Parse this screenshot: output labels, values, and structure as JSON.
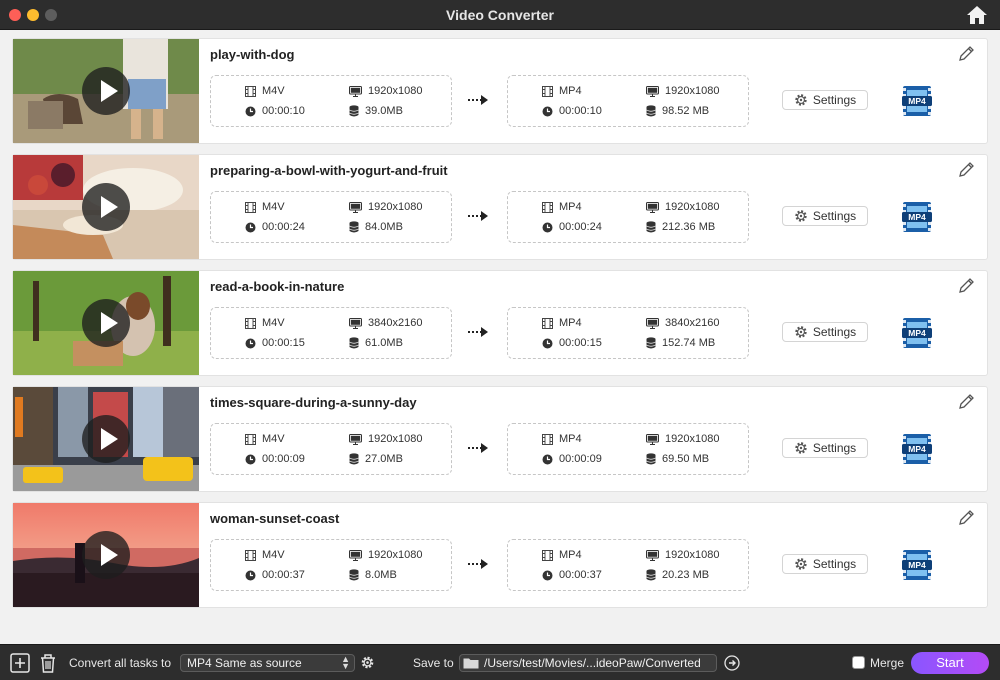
{
  "window": {
    "title": "Video Converter"
  },
  "tasks": [
    {
      "name": "play-with-dog",
      "src": {
        "format": "M4V",
        "resolution": "1920x1080",
        "duration": "00:00:10",
        "size": "39.0MB"
      },
      "dst": {
        "format": "MP4",
        "resolution": "1920x1080",
        "duration": "00:00:10",
        "size": "98.52 MB"
      },
      "settings_label": "Settings",
      "target_badge": "MP4"
    },
    {
      "name": "preparing-a-bowl-with-yogurt-and-fruit",
      "src": {
        "format": "M4V",
        "resolution": "1920x1080",
        "duration": "00:00:24",
        "size": "84.0MB"
      },
      "dst": {
        "format": "MP4",
        "resolution": "1920x1080",
        "duration": "00:00:24",
        "size": "212.36 MB"
      },
      "settings_label": "Settings",
      "target_badge": "MP4"
    },
    {
      "name": "read-a-book-in-nature",
      "src": {
        "format": "M4V",
        "resolution": "3840x2160",
        "duration": "00:00:15",
        "size": "61.0MB"
      },
      "dst": {
        "format": "MP4",
        "resolution": "3840x2160",
        "duration": "00:00:15",
        "size": "152.74 MB"
      },
      "settings_label": "Settings",
      "target_badge": "MP4"
    },
    {
      "name": "times-square-during-a-sunny-day",
      "src": {
        "format": "M4V",
        "resolution": "1920x1080",
        "duration": "00:00:09",
        "size": "27.0MB"
      },
      "dst": {
        "format": "MP4",
        "resolution": "1920x1080",
        "duration": "00:00:09",
        "size": "69.50 MB"
      },
      "settings_label": "Settings",
      "target_badge": "MP4"
    },
    {
      "name": "woman-sunset-coast",
      "src": {
        "format": "M4V",
        "resolution": "1920x1080",
        "duration": "00:00:37",
        "size": "8.0MB"
      },
      "dst": {
        "format": "MP4",
        "resolution": "1920x1080",
        "duration": "00:00:37",
        "size": "20.23 MB"
      },
      "settings_label": "Settings",
      "target_badge": "MP4"
    }
  ],
  "bottom": {
    "convert_label": "Convert all tasks to",
    "convert_value": "MP4 Same as source",
    "save_label": "Save to",
    "save_path": "/Users/test/Movies/...ideoPaw/Converted",
    "merge_label": "Merge",
    "start_label": "Start"
  },
  "colors": {
    "accent_start": "#8a56ff",
    "accent_end": "#b44bf6",
    "mp4_badge": "#2e8fd8"
  }
}
